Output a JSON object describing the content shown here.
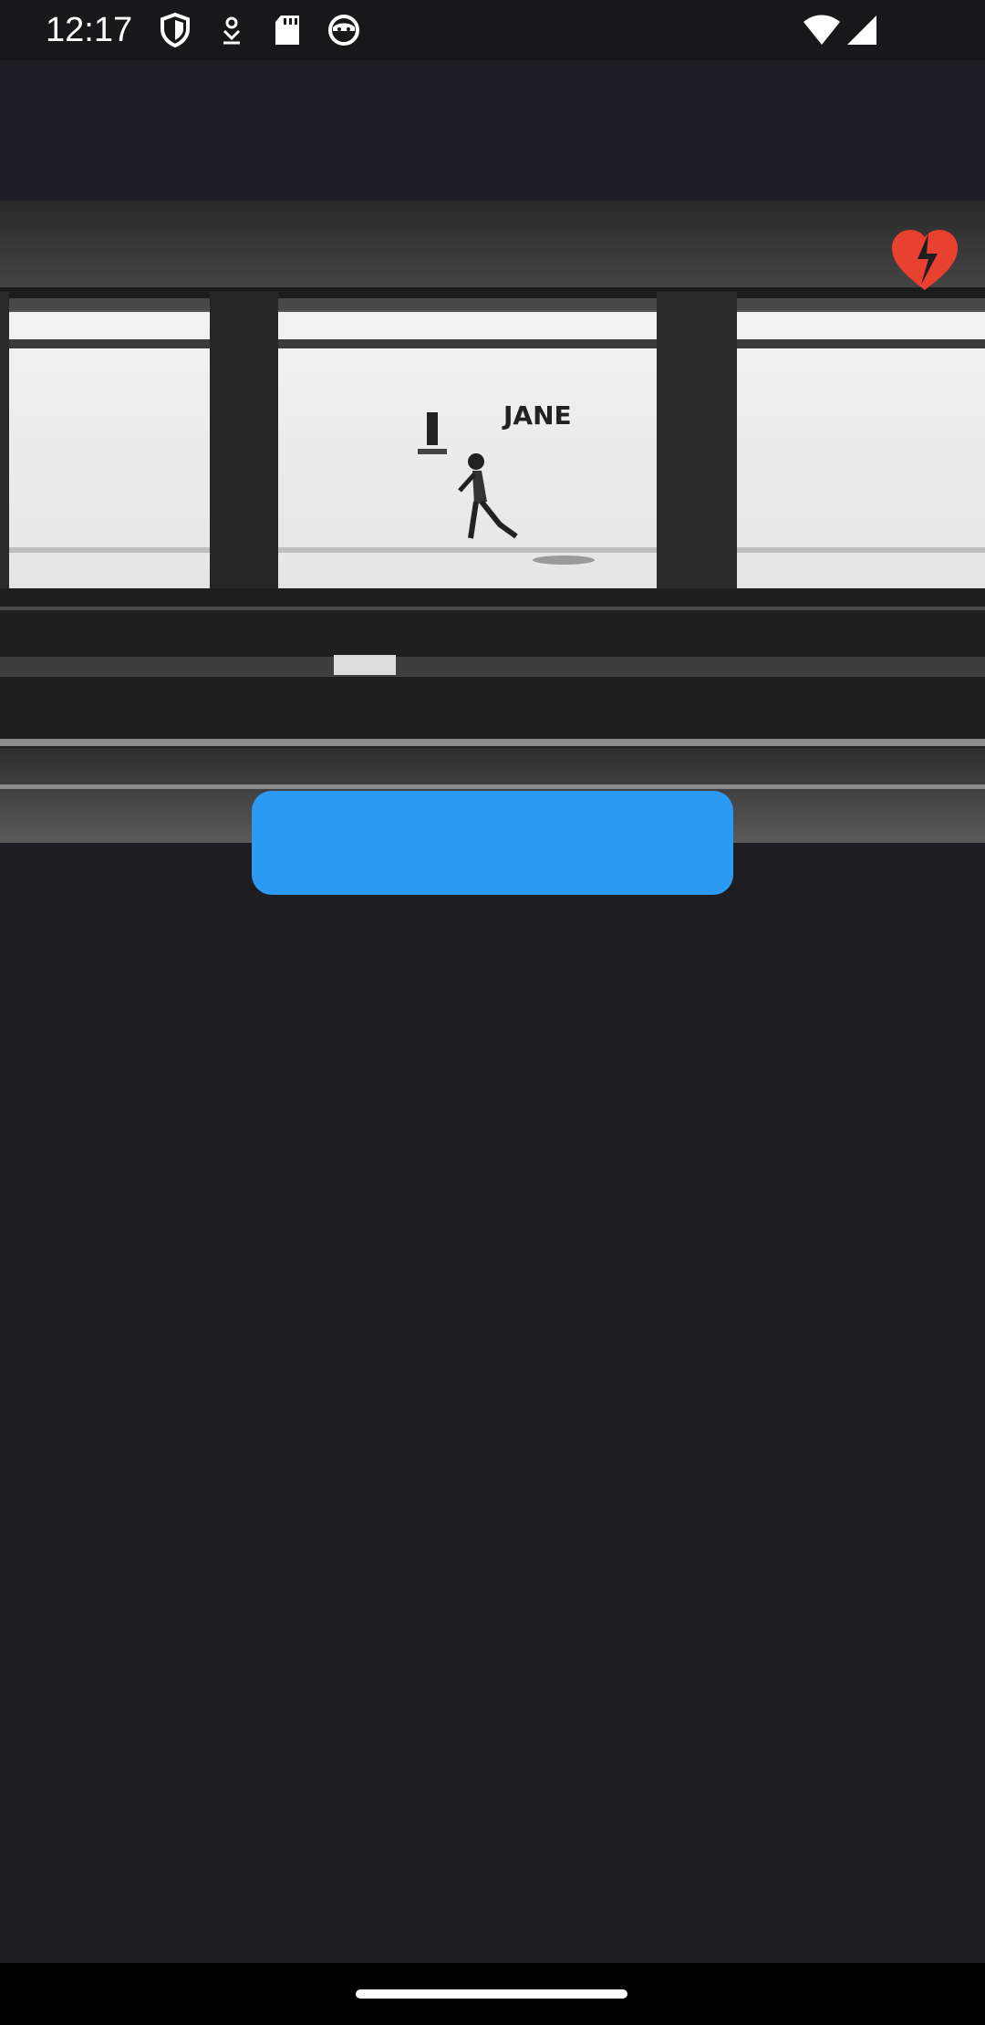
{
  "status_bar": {
    "time": "12:17",
    "icons": [
      "shield-icon",
      "download-icon",
      "sd-card-icon",
      "cat-face-icon"
    ],
    "right_icons": [
      "wifi-icon",
      "signal-icon"
    ]
  },
  "hero": {
    "image_description_icon": "subway-platform-photo",
    "sign_text": "JANE"
  },
  "actions": {
    "favorite_icon": "broken-heart-icon",
    "favorite_color": "#e8412f",
    "primary_button_label": "",
    "primary_color": "#2b9af2"
  },
  "colors": {
    "background": "#1e1d22",
    "status_bar": "#18181b"
  }
}
